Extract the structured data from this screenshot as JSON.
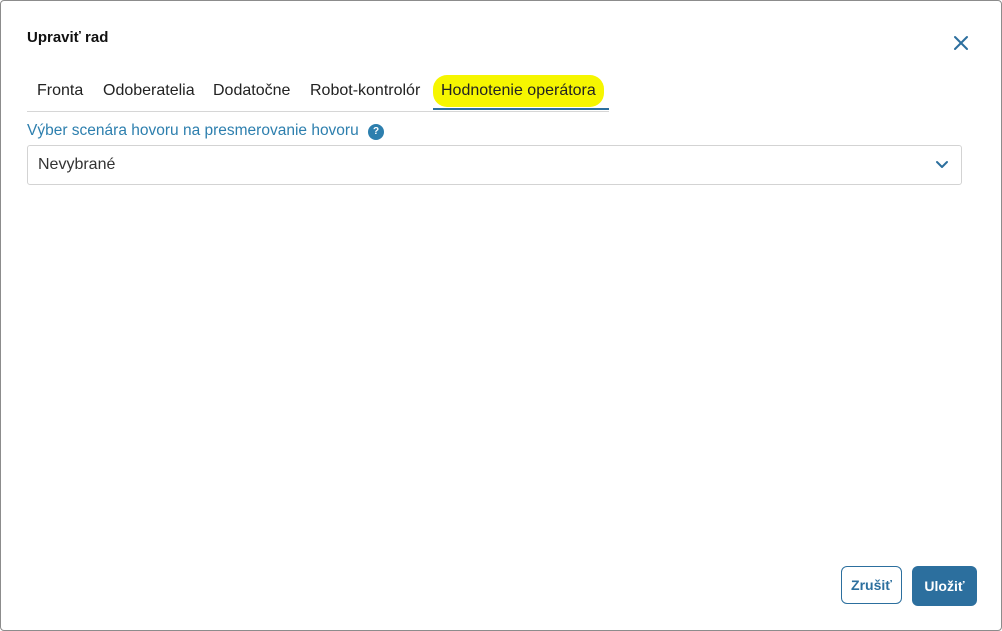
{
  "dialog": {
    "title": "Upraviť rad"
  },
  "tabs": [
    {
      "label": "Fronta"
    },
    {
      "label": "Odoberatelia"
    },
    {
      "label": "Dodatočne"
    },
    {
      "label": "Robot-kontrolór"
    },
    {
      "label": "Hodnotenie operátora",
      "active": true
    }
  ],
  "form": {
    "label": "Výber scenára hovoru na presmerovanie hovoru",
    "help_icon_text": "?",
    "select_value": "Nevybrané"
  },
  "buttons": {
    "cancel": "Zrušiť",
    "save": "Uložiť"
  },
  "colors": {
    "accent": "#2c6f9e",
    "label": "#2d7fae",
    "active_tab_highlight": "#f6f600"
  },
  "icons": {
    "close": "close-icon",
    "chevron": "chevron-down-icon",
    "help": "help-icon"
  }
}
